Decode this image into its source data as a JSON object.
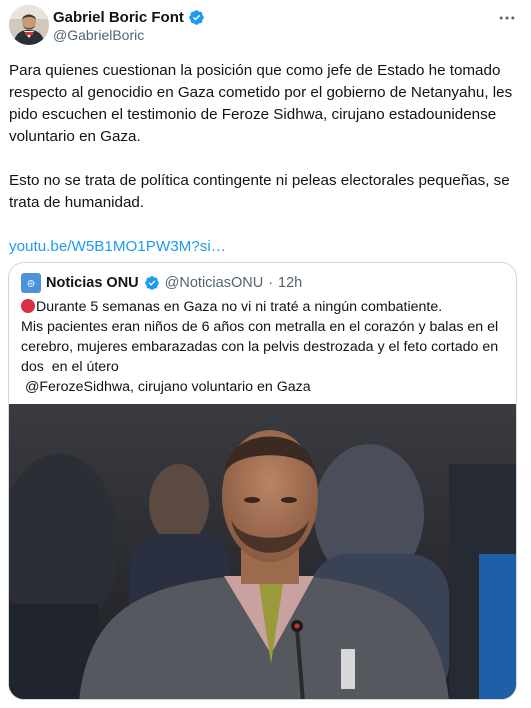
{
  "author": {
    "display_name": "Gabriel Boric Font",
    "handle": "@GabrielBoric",
    "avatar_icon": "profile-photo",
    "verified_icon": "verified-badge-icon",
    "verified_color": "#1d9bf0"
  },
  "more_icon": "more-horizontal-icon",
  "tweet": {
    "paragraph_1": "Para quienes cuestionan la posición que como jefe de Estado he tomado respecto al genocidio en Gaza cometido por el gobierno de Netanyahu, les pido escuchen el testimonio de Feroze Sidhwa, cirujano estadounidense voluntario en Gaza.",
    "paragraph_2": "Esto no se trata de política contingente ni peleas electorales pequeñas, se trata de humanidad.",
    "link": "youtu.be/W5B1MO1PW3M?si…",
    "link_color": "#1d9bf0"
  },
  "quote": {
    "display_name": "Noticias ONU",
    "handle": "@NoticiasONU",
    "separator": "·",
    "time": "12h",
    "avatar_label": "Noticias ONU",
    "line_1": "Durante 5 semanas en Gaza no vi ni traté a ningún combatiente.",
    "line_2": "Mis pacientes eran niños de 6 años con metralla en el corazón y balas en el",
    "line_3": "cerebro, mujeres embarazadas con la pelvis destrozada y el feto cortado en",
    "line_4": "dos  en el útero",
    "line_5": " @FerozeSidhwa, cirujano voluntario en Gaza",
    "red_dot_icon": "red-circle-icon",
    "media": "photo of man speaking at microphone in UN chamber"
  }
}
